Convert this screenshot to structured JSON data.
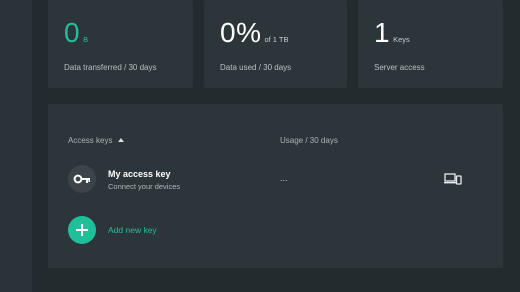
{
  "stats": [
    {
      "value": "0",
      "unit": "B",
      "label": "Data transferred / 30 days"
    },
    {
      "value": "0%",
      "unit": "of 1 TB",
      "label": "Data used / 30 days"
    },
    {
      "value": "1",
      "unit": "Keys",
      "label": "Server access"
    }
  ],
  "keys_table": {
    "header_keys": "Access keys",
    "header_usage": "Usage / 30 days",
    "rows": [
      {
        "name": "My access key",
        "subtitle": "Connect your devices",
        "usage": "..."
      }
    ],
    "add_label": "Add new key"
  },
  "icons": {
    "avatar": "key-icon",
    "sort": "sort-asc-icon",
    "device": "devices-icon",
    "add": "plus-icon"
  },
  "colors": {
    "accent": "#1fbf9a",
    "background": "#232b2f",
    "card": "#2c3539"
  }
}
